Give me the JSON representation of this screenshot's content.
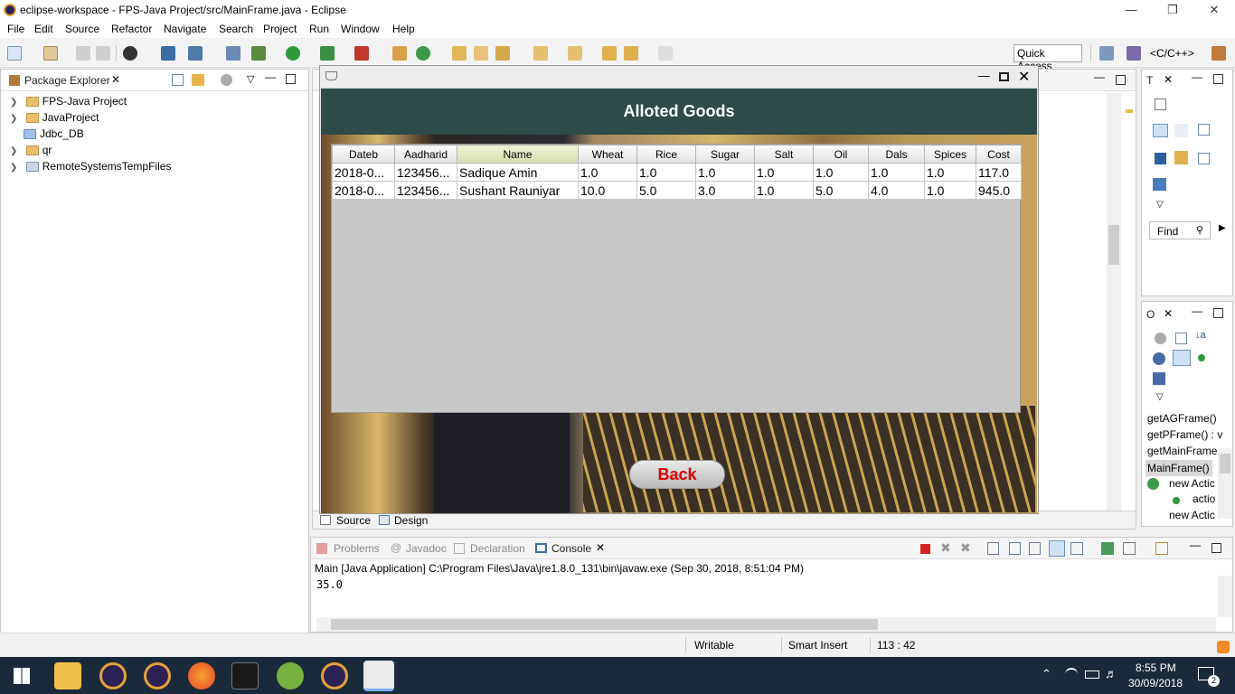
{
  "window": {
    "title": "eclipse-workspace - FPS-Java Project/src/MainFrame.java - Eclipse"
  },
  "menu": [
    "File",
    "Edit",
    "Source",
    "Refactor",
    "Navigate",
    "Search",
    "Project",
    "Run",
    "Window",
    "Help"
  ],
  "quick_access": "Quick Access",
  "perspective": "<C/C++>",
  "package_explorer": {
    "title": "Package Explorer",
    "items": [
      "FPS-Java Project",
      "JavaProject",
      "Jdbc_DB",
      "qr",
      "RemoteSystemsTempFiles"
    ]
  },
  "swing_frame": {
    "heading": "Alloted Goods",
    "columns": [
      "Dateb",
      "Aadharid",
      "Name",
      "Wheat",
      "Rice",
      "Sugar",
      "Salt",
      "Oil",
      "Dals",
      "Spices",
      "Cost"
    ],
    "rows": [
      [
        "2018-0...",
        "123456...",
        "Sadique Amin",
        "1.0",
        "1.0",
        "1.0",
        "1.0",
        "1.0",
        "1.0",
        "1.0",
        "117.0"
      ],
      [
        "2018-0...",
        "123456...",
        "Sushant Rauniyar",
        "10.0",
        "5.0",
        "3.0",
        "1.0",
        "5.0",
        "4.0",
        "1.0",
        "945.0"
      ]
    ],
    "back_label": "Back"
  },
  "editor_tabs": {
    "source": "Source",
    "design": "Design"
  },
  "right_panel_top": {
    "tab": "T",
    "find": "Find"
  },
  "outline": {
    "tab": "O",
    "items": [
      "getAGFrame()",
      "getPFrame() : v",
      "getMainFrame",
      "MainFrame()",
      "new Actic",
      "actio",
      "new Actic"
    ]
  },
  "bottom_tabs": [
    "Problems",
    "Javadoc",
    "Declaration",
    "Console"
  ],
  "console": {
    "header": "Main [Java Application] C:\\Program Files\\Java\\jre1.8.0_131\\bin\\javaw.exe (Sep 30, 2018, 8:51:04 PM)",
    "output": "35.0"
  },
  "status": {
    "writable": "Writable",
    "insert": "Smart Insert",
    "position": "113 : 42"
  },
  "taskbar": {
    "time": "8:55 PM",
    "date": "30/09/2018",
    "notifications": "2"
  }
}
